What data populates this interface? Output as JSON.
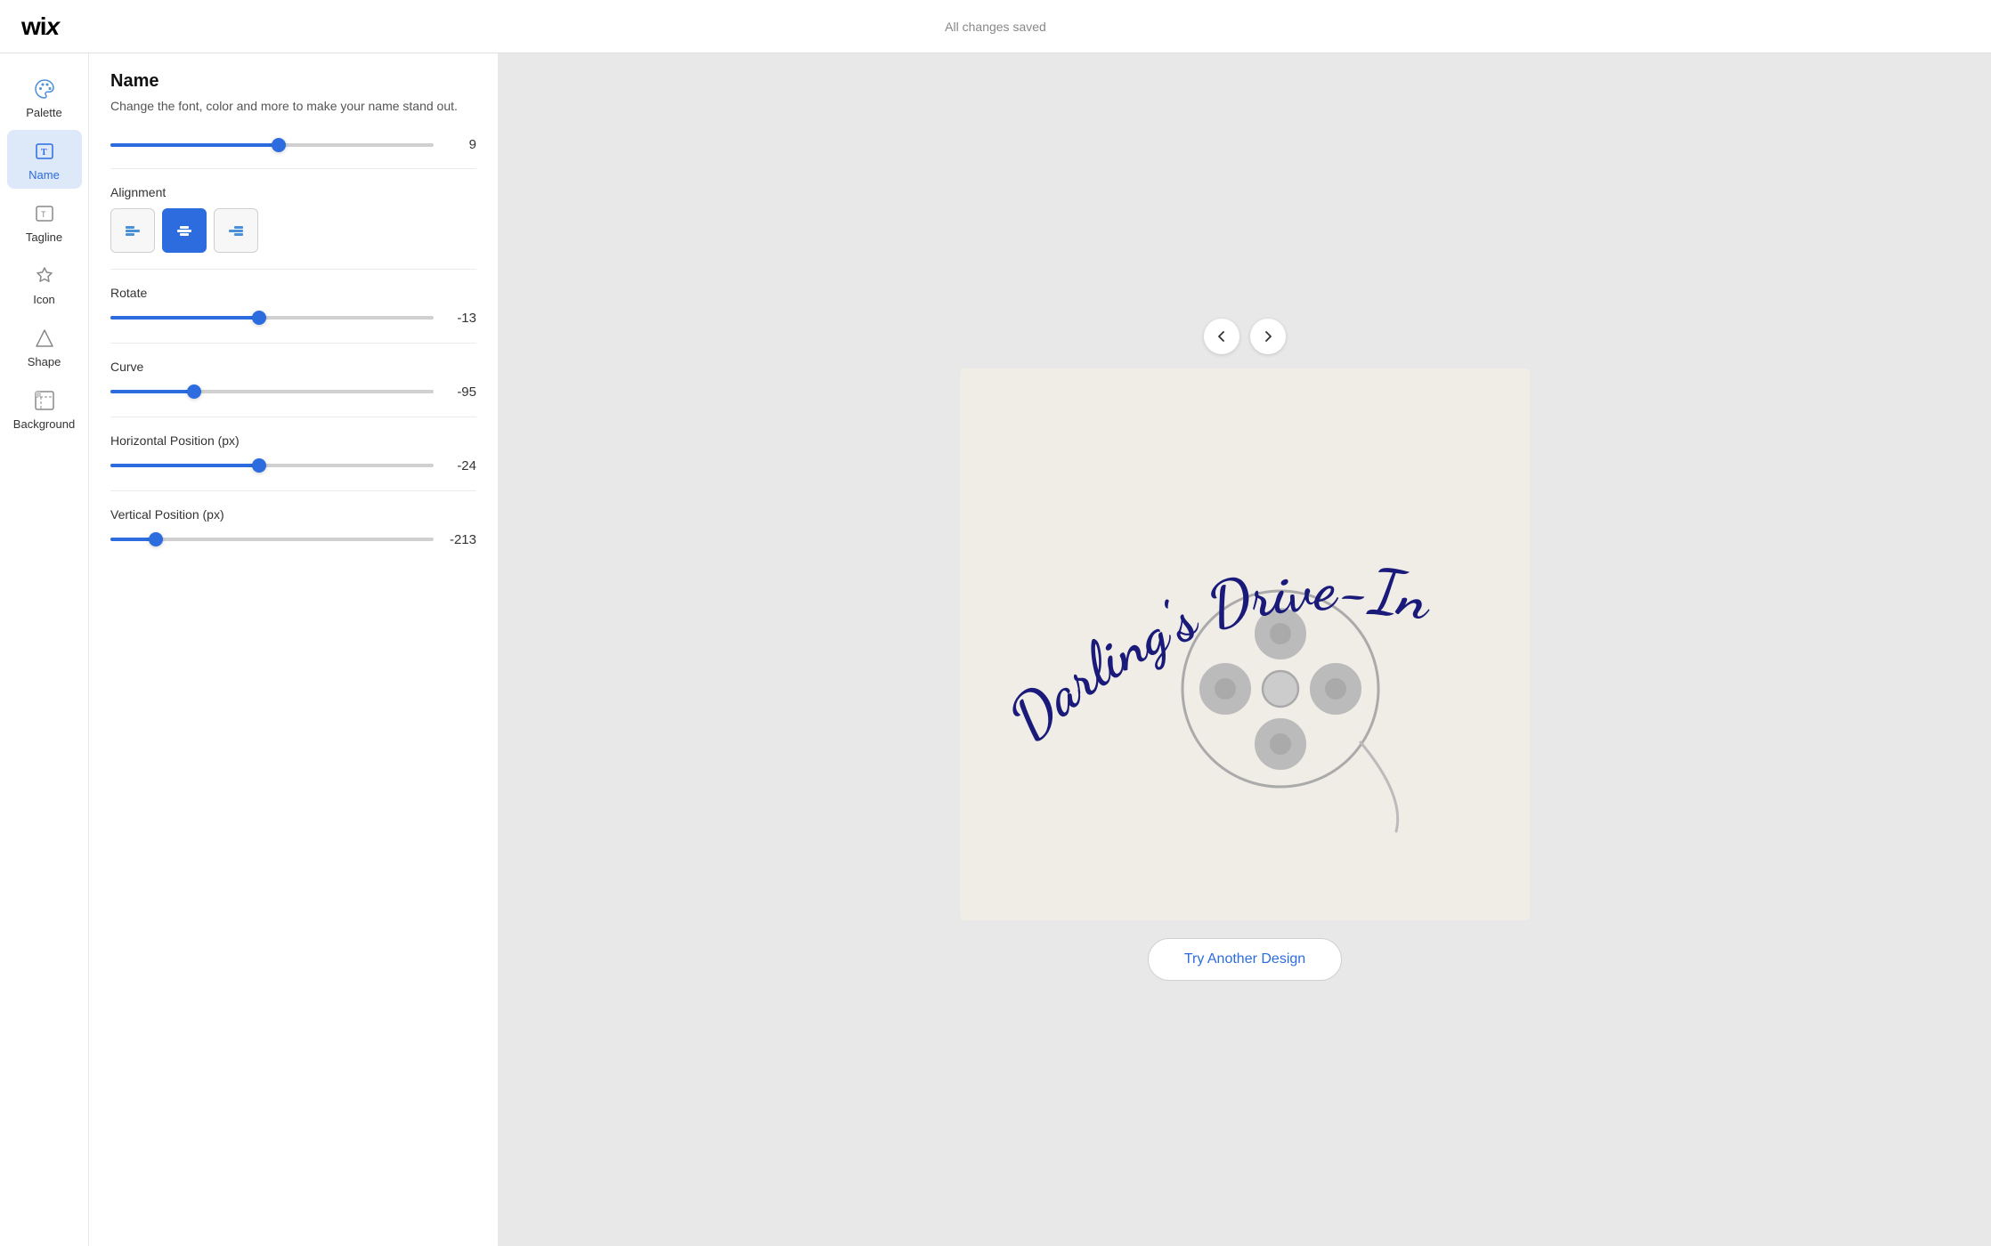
{
  "topbar": {
    "logo": "WiX",
    "status": "All changes saved"
  },
  "sidebar": {
    "items": [
      {
        "id": "palette",
        "label": "Palette",
        "icon": "palette-icon",
        "active": false
      },
      {
        "id": "name",
        "label": "Name",
        "icon": "name-icon",
        "active": true
      },
      {
        "id": "tagline",
        "label": "Tagline",
        "icon": "tagline-icon",
        "active": false
      },
      {
        "id": "icon",
        "label": "Icon",
        "icon": "star-icon",
        "active": false
      },
      {
        "id": "shape",
        "label": "Shape",
        "icon": "shape-icon",
        "active": false
      },
      {
        "id": "background",
        "label": "Background",
        "icon": "background-icon",
        "active": false
      }
    ]
  },
  "panel": {
    "title": "Name",
    "subtitle": "Change the font, color and more to make your name stand out.",
    "partial_value": "9",
    "alignment": {
      "label": "Alignment",
      "options": [
        "left",
        "center",
        "right"
      ],
      "active": "center"
    },
    "rotate": {
      "label": "Rotate",
      "value": -13,
      "min": -180,
      "max": 180,
      "percent": 46
    },
    "curve": {
      "label": "Curve",
      "value": -95,
      "min": -200,
      "max": 200,
      "percent": 26
    },
    "horizontal_position": {
      "label": "Horizontal Position (px)",
      "value": -24,
      "min": -300,
      "max": 300,
      "percent": 46
    },
    "vertical_position": {
      "label": "Vertical Position (px)",
      "value": -213,
      "min": -300,
      "max": 300,
      "percent": 14
    }
  },
  "canvas": {
    "logo_text": "Darling's Drive-In",
    "nav_prev": "<",
    "nav_next": ">",
    "try_another_label": "Try Another Design"
  }
}
